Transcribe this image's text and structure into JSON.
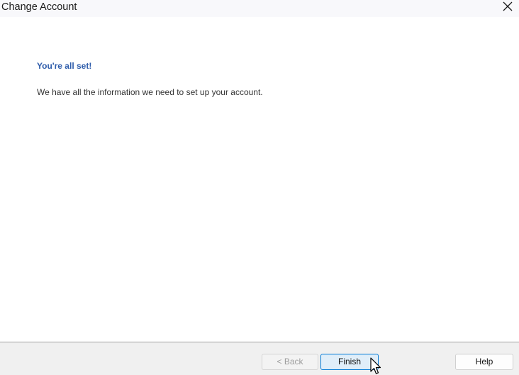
{
  "window": {
    "title": "Change Account"
  },
  "content": {
    "heading": "You're all set!",
    "message": "We have all the information we need to set up your account."
  },
  "footer": {
    "back_label": "< Back",
    "finish_label": "Finish",
    "help_label": "Help"
  },
  "icons": {
    "close": "close-icon",
    "cursor": "mouse-pointer-icon"
  },
  "colors": {
    "heading": "#2f5dab",
    "accent": "#0078d4"
  }
}
